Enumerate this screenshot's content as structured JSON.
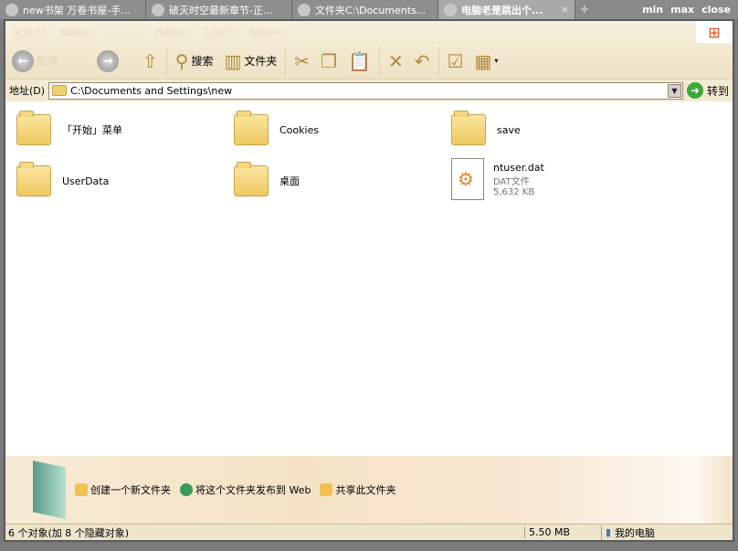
{
  "tabs": [
    {
      "label": "new书架 万卷书屋-手..."
    },
    {
      "label": "破灭时空最新章节-正..."
    },
    {
      "label": "文件夹C:\\Documents..."
    },
    {
      "label": "电脑老是跳出个...",
      "close": "×"
    }
  ],
  "window_buttons": {
    "min": "min",
    "max": "max",
    "close": "close"
  },
  "menu": [
    "文件(F)",
    "编辑(E)",
    "查看(V)",
    "收藏(A)",
    "工具(T)",
    "帮助(H)"
  ],
  "toolbar": {
    "back": "后退",
    "search": "搜索",
    "folders": "文件夹"
  },
  "address": {
    "label": "地址(D)",
    "value": "C:\\Documents and Settings\\new",
    "go": "转到"
  },
  "items": [
    {
      "name": "「开始」菜单"
    },
    {
      "name": "Cookies"
    },
    {
      "name": "save"
    },
    {
      "name": "UserData"
    },
    {
      "name": "桌面"
    },
    {
      "name": "ntuser.dat",
      "type": "DAT文件",
      "size": "5,632 KB"
    }
  ],
  "tasks": [
    "创建一个新文件夹",
    "将这个文件夹发布到 Web",
    "共享此文件夹"
  ],
  "status": {
    "objects": "6 个对象(加 8 个隐藏对象)",
    "size": "5.50 MB",
    "location": "我的电脑"
  }
}
